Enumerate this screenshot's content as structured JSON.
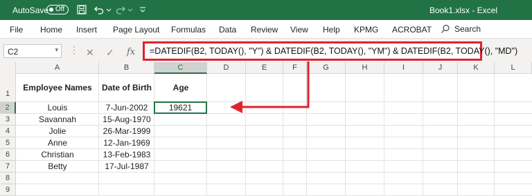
{
  "titlebar": {
    "autosave_label": "AutoSave",
    "toggle_state": "Off",
    "doc_title": "Book1.xlsx  -  Excel",
    "accent": "#217346"
  },
  "menu": {
    "items": [
      "File",
      "Home",
      "Insert",
      "Page Layout",
      "Formulas",
      "Data",
      "Review",
      "View",
      "Help",
      "KPMG",
      "ACROBAT"
    ],
    "search_label": "Search"
  },
  "formula_bar": {
    "name_box": "C2",
    "formula": "=DATEDIF(B2, TODAY(), \"Y\") & DATEDIF(B2, TODAY(), \"YM\") & DATEDIF(B2, TODAY(), \"MD\")",
    "highlight_color": "#e0222d"
  },
  "sheet": {
    "columns": [
      "A",
      "B",
      "C",
      "D",
      "E",
      "F",
      "G",
      "H",
      "I",
      "J",
      "K",
      "L"
    ],
    "rows": [
      "1",
      "2",
      "3",
      "4",
      "5",
      "6",
      "7",
      "8",
      "9"
    ],
    "headers": {
      "a1": "Employee Names",
      "b1": "Date of Birth",
      "c1": "Age"
    },
    "names": [
      "Louis",
      "Savannah",
      "Jolie",
      "Anne",
      "Christian",
      "Betty"
    ],
    "dobs": [
      "7-Jun-2002",
      "15-Aug-1970",
      "26-Mar-1999",
      "12-Jan-1969",
      "13-Feb-1983",
      "17-Jul-1987"
    ],
    "c2": "19621"
  }
}
